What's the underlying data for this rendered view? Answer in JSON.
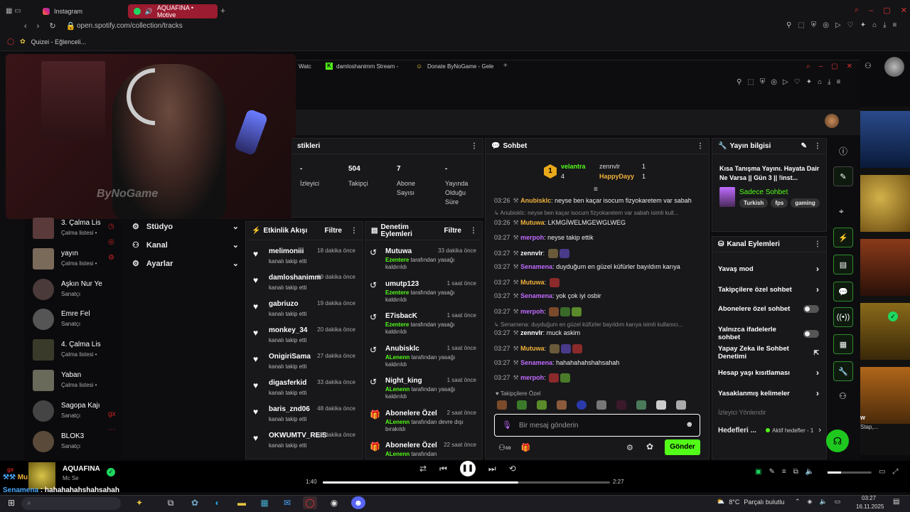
{
  "browser": {
    "tabs": [
      {
        "label": "Instagram"
      },
      {
        "label": "AQUAFINA • Motive"
      }
    ],
    "url": "open.spotify.com/collection/tracks",
    "bookmark": "Quizei - Eğlenceli..."
  },
  "inner_browser": {
    "tabs": [
      {
        "label": "Watc"
      },
      {
        "label": "damloshanimm Stream - "
      },
      {
        "label": "Donate ByNoGame - Gele"
      }
    ]
  },
  "webcam": {
    "watermark": "ByNoGame"
  },
  "stats": {
    "title": "stikleri",
    "items": [
      {
        "value": "-",
        "label": "İzleyici"
      },
      {
        "value": "504",
        "label": "Takipçi"
      },
      {
        "value": "7",
        "label": "Abone Sayısı"
      },
      {
        "value": "-",
        "label": "Yayında Olduğu Süre"
      }
    ]
  },
  "left_menu": [
    {
      "label": "Stüdyo"
    },
    {
      "label": "Kanal"
    },
    {
      "label": "Ayarlar"
    }
  ],
  "activity": {
    "title": "Etkinlik Akışı",
    "filter": "Filtre",
    "items": [
      {
        "name": "melimoniii",
        "time": "18 dakika önce",
        "sub": "kanalı takip etti"
      },
      {
        "name": "damloshanimm",
        "time": "19 dakika önce",
        "sub": "kanalı takip etti"
      },
      {
        "name": "gabriuzo",
        "time": "19 dakika önce",
        "sub": "kanalı takip etti"
      },
      {
        "name": "monkey_34",
        "time": "20 dakika önce",
        "sub": "kanalı takip etti"
      },
      {
        "name": "OnigiriSama",
        "time": "27 dakika önce",
        "sub": "kanalı takip etti"
      },
      {
        "name": "digasferkid",
        "time": "33 dakika önce",
        "sub": "kanalı takip etti"
      },
      {
        "name": "baris_znd06",
        "time": "48 dakika önce",
        "sub": "kanalı takip etti"
      },
      {
        "name": "OKWUMTV_REIS",
        "time": "55 dakika önce",
        "sub": "kanalı takip etti"
      }
    ]
  },
  "moderation": {
    "title": "Denetim Eylemleri",
    "filter": "Filtre",
    "items": [
      {
        "name": "Mutuwa",
        "time": "33 dakika önce",
        "by": "Ezentere",
        "sub": " tarafından yasağı kaldırıldı"
      },
      {
        "name": "umutp123",
        "time": "1 saat önce",
        "by": "Ezentere",
        "sub": " tarafından yasağı kaldırıldı"
      },
      {
        "name": "E7isbacK",
        "time": "1 saat önce",
        "by": "Ezentere",
        "sub": " tarafından yasağı kaldırıldı"
      },
      {
        "name": "Anubisklc",
        "time": "1 saat önce",
        "by": "ALenenn",
        "sub": " tarafından yasağı kaldırıldı"
      },
      {
        "name": "Night_king",
        "time": "1 saat önce",
        "by": "ALenenn",
        "sub": " tarafından yasağı kaldırıldı"
      },
      {
        "name": "Abonelere Özel",
        "time": "2 saat önce",
        "by": "ALenenn",
        "sub": " tarafından devre dışı bırakıldı"
      },
      {
        "name": "Abonelere Özel",
        "time": "22 saat önce",
        "by": "ALenenn",
        "sub": " tarafından"
      }
    ]
  },
  "chat": {
    "title": "Sohbet",
    "top": [
      {
        "rank": "1",
        "name": "velantra",
        "count": "4"
      },
      {
        "name": "zennvlr",
        "count": "1"
      },
      {
        "name": "HappyDayy",
        "count": "1"
      }
    ],
    "lines": [
      {
        "time": "03:26",
        "user": "Anubisklc",
        "cls": "u-or",
        "msg": "neyse ben kaçar isocum fizyokaretem var sabah"
      },
      {
        "sys": "Anubisklc: neyse ben kaçar isocum fizyokaretem var sabah isimli kull..."
      },
      {
        "time": "03:26",
        "user": "Mutuwa",
        "cls": "u-or",
        "msg": "LKMGİWELMGEWGLWEG"
      },
      {
        "time": "03:27",
        "user": "merpoh",
        "cls": "u-pu",
        "msg": "neyse takip ettik"
      },
      {
        "time": "03:27",
        "user": "zennvlr",
        "cls": "u-wh",
        "msg": ""
      },
      {
        "time": "03:27",
        "user": "Senamena",
        "cls": "u-pu",
        "msg": "duyduğum en güzel küfürler bayıldım karıya"
      },
      {
        "time": "03:27",
        "user": "Mutuwa",
        "cls": "u-or",
        "msg": ""
      },
      {
        "time": "03:27",
        "user": "Senamena",
        "cls": "u-pu",
        "msg": "yok çok iyi osbir"
      },
      {
        "time": "03:27",
        "user": "merpoh",
        "cls": "u-pu",
        "msg": ""
      },
      {
        "sys": "Senamena: duyduğum en güzel küfürler bayıldım karıya isimli kullanıcı..."
      },
      {
        "time": "03:27",
        "user": "zennvlr",
        "cls": "u-wh",
        "msg": "muck askim"
      },
      {
        "time": "03:27",
        "user": "Mutuwa",
        "cls": "u-or",
        "msg": ""
      },
      {
        "time": "03:27",
        "user": "Senamena",
        "cls": "u-pu",
        "msg": "hahahahahshahsahah"
      },
      {
        "time": "03:27",
        "user": "merpoh",
        "cls": "u-pu",
        "msg": ""
      }
    ],
    "followers_only": "Takipçilere Özel",
    "placeholder": "Bir mesaj gönderin",
    "send": "Gönder"
  },
  "stream_info": {
    "title": "Yayın bilgisi",
    "stream_title": "Kısa Tanışma Yayını. Hayata Dair Ne Varsa || Gün 3 || !inst...",
    "category": "Sadece Sohbet",
    "tags": [
      "Turkish",
      "fps",
      "gaming"
    ]
  },
  "channel_actions": {
    "title": "Kanal Eylemleri",
    "items": [
      {
        "label": "Yavaş mod",
        "type": "chevron"
      },
      {
        "label": "Takipçilere özel sohbet",
        "type": "chevron"
      },
      {
        "label": "Abonelere özel sohbet",
        "type": "toggle"
      },
      {
        "label": "Yalnızca ifadelerle sohbet",
        "type": "toggle"
      },
      {
        "label": "Yapay Zeka ile Sohbet Denetimi",
        "type": "external"
      },
      {
        "label": "Hesap yaşı kısıtlaması",
        "type": "chevron"
      },
      {
        "label": "Yasaklanmış kelimeler",
        "type": "chevron"
      }
    ],
    "viewer_redirect": "İzleyici Yönlendir",
    "goals": "Hedefleri ...",
    "goals_active": "Aktif hedefler - 1"
  },
  "spotify_sidebar": [
    {
      "name": "3. Çalma Lis",
      "sub": "Çalma listesi •"
    },
    {
      "name": "yayın",
      "sub": "Çalma listesi •"
    },
    {
      "name": "Aşkın Nur Ye",
      "sub": "Sanatçı"
    },
    {
      "name": "Emre Fel",
      "sub": "Sanatçı"
    },
    {
      "name": "4. Çalma Lis",
      "sub": "Çalma listesi •"
    },
    {
      "name": "Yaban",
      "sub": "Çalma listesi •"
    },
    {
      "name": "Sagopa Kajı",
      "sub": "Sanatçı"
    },
    {
      "name": "BLOK3",
      "sub": "Sanatçı"
    }
  ],
  "player": {
    "track": "AQUAFINA",
    "artist": "Mc Se",
    "elapsed": "1:40",
    "total": "2:27",
    "progress": 0.68
  },
  "overlay": {
    "line1_user": "Mu",
    "line2_user": "Senamena",
    "line2_msg": "hahahahahshahsahah"
  },
  "album_labels": [
    "w",
    "Stap,..."
  ],
  "taskbar": {
    "weather_temp": "8°C",
    "weather_text": "Parçalı bulutlu",
    "time": "03:27",
    "date": "16.11.2025"
  },
  "colors": {
    "kick_green": "#53fc18",
    "spotify_green": "#1ed760",
    "bg": "#18181b"
  }
}
